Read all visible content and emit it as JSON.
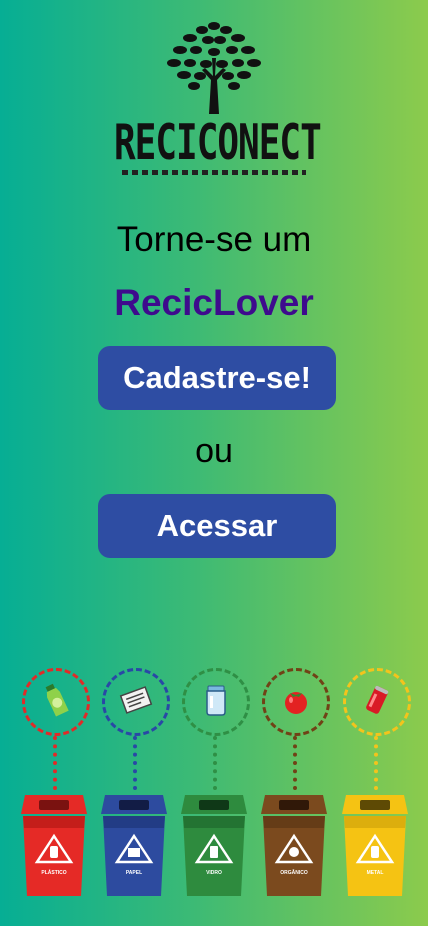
{
  "logo": {
    "text": "RECICONECT",
    "icon": "tree-icon"
  },
  "headline": "Torne-se um",
  "brand": "RecicLover",
  "signup_button": "Cadastre-se!",
  "or_text": "ou",
  "login_button": "Acessar",
  "bins": [
    {
      "label": "PLÁSTICO",
      "color": "#e52a26",
      "dot": "#e02b28",
      "item": "plastic-bottle-icon"
    },
    {
      "label": "PAPEL",
      "color": "#2d4b9f",
      "dot": "#2948a6",
      "item": "newspaper-icon"
    },
    {
      "label": "VIDRO",
      "color": "#2e8b3e",
      "dot": "#2f8f45",
      "item": "glass-jar-icon"
    },
    {
      "label": "ORGÂNICO",
      "color": "#7b4a1e",
      "dot": "#704216",
      "item": "tomato-icon"
    },
    {
      "label": "METAL",
      "color": "#f5c313",
      "dot": "#f3c41c",
      "item": "soda-can-icon"
    }
  ],
  "colors": {
    "button": "#2e4da3",
    "brand_text": "#3e0b8d"
  }
}
